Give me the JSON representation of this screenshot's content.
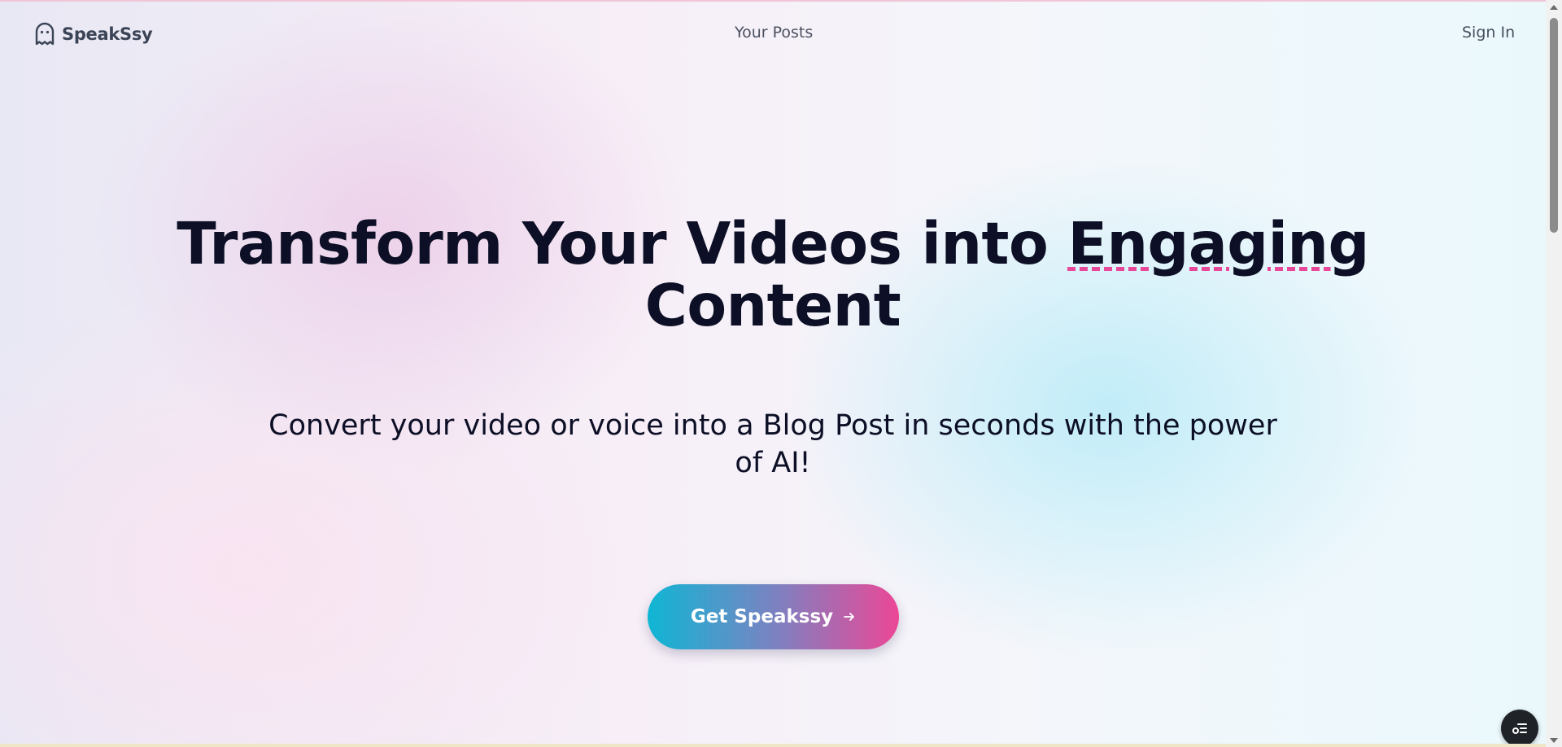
{
  "header": {
    "brand": "SpeakSsy",
    "nav_posts": "Your Posts",
    "sign_in": "Sign In"
  },
  "hero": {
    "title_line1_prefix": "Transform Your Videos into ",
    "title_highlight": "Engaging",
    "title_line2": "Content",
    "subtitle": "Convert your video or voice into a Blog Post in seconds with the power of AI!",
    "cta_label": "Get Speakssy"
  },
  "icons": {
    "brand": "ghost-icon",
    "cta": "arrow-right-icon",
    "fab": "toggle-list-icon"
  },
  "colors": {
    "cta_gradient_start": "#0fb6d4",
    "cta_gradient_end": "#ec4796",
    "highlight_underline": "#e8489a",
    "heading_text": "#0c0f25"
  }
}
